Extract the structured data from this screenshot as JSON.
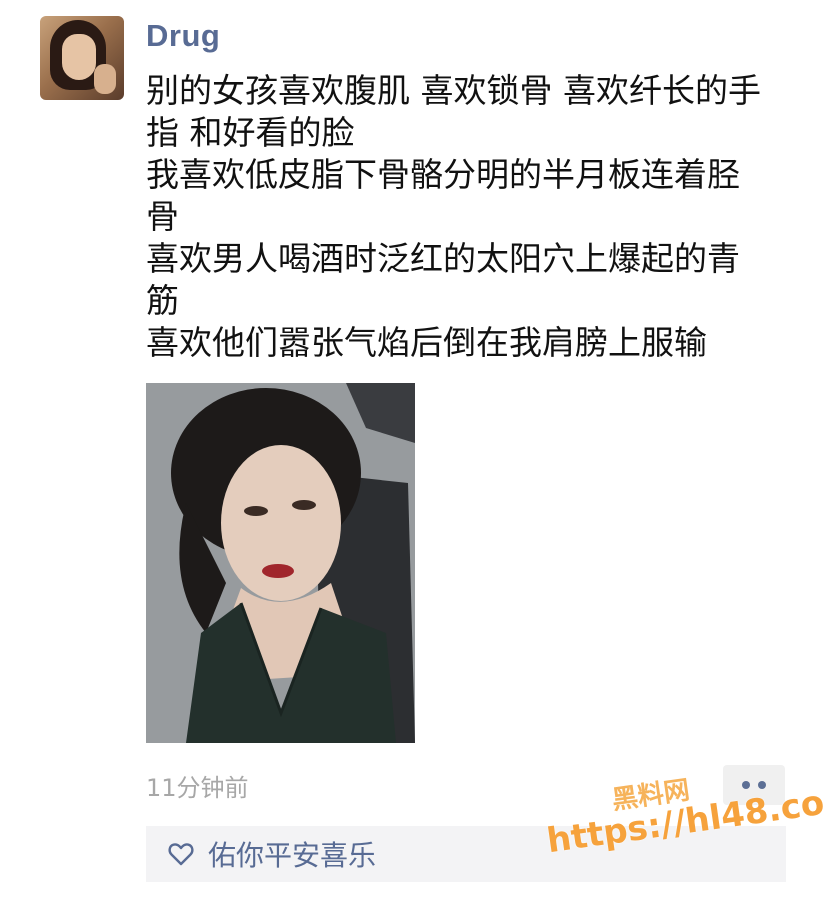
{
  "post": {
    "username": "Drug",
    "text_lines": [
      "别的女孩喜欢腹肌 喜欢锁骨 喜欢纤长的手",
      "指 和好看的脸",
      "我喜欢低皮脂下骨骼分明的半月板连着胫",
      "骨",
      "喜欢男人喝酒时泛红的太阳穴上爆起的青",
      "筋",
      "喜欢他们嚣张气焰后倒在我肩膀上服输"
    ],
    "timestamp": "11分钟前",
    "likes": {
      "icon": "heart-outline-icon",
      "names": "佑你平安喜乐"
    }
  },
  "watermark": {
    "title": "黑料网",
    "url": "https://hl48.co"
  },
  "colors": {
    "username": "#586b94",
    "text": "#111111",
    "timestamp": "#a7a7a7",
    "likes_bg": "#f3f3f5",
    "more_button_bg": "#f0f0f0",
    "watermark": "#f6a23c"
  }
}
